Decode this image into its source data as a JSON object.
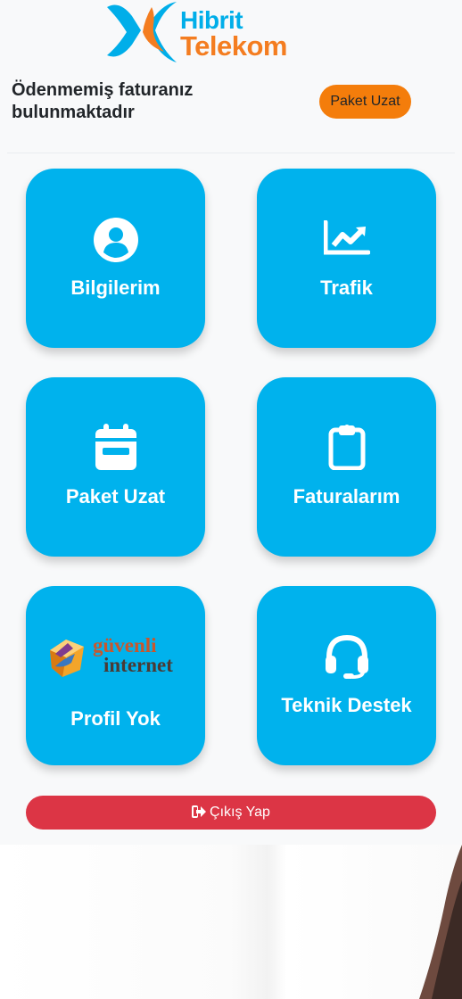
{
  "brand": {
    "line1": "Hibrit",
    "line2": "Telekom"
  },
  "notice": {
    "text": "Ödenmemiş faturanız bulunmaktadır"
  },
  "header": {
    "extend_button_label": "Paket Uzat"
  },
  "tiles": [
    {
      "label": "Bilgilerim",
      "icon": "user-circle-icon"
    },
    {
      "label": "Trafik",
      "icon": "chart-line-icon"
    },
    {
      "label": "Paket Uzat",
      "icon": "calendar-icon"
    },
    {
      "label": "Faturalarım",
      "icon": "clipboard-icon"
    },
    {
      "label": "Profil Yok",
      "icon": "guvenli-internet-logo",
      "logo_text": [
        "güvenli",
        "internet"
      ]
    },
    {
      "label": "Teknik Destek",
      "icon": "headset-icon"
    }
  ],
  "logout": {
    "label": "Çıkış Yap",
    "icon": "sign-out-icon"
  },
  "colors": {
    "accent": "#00b2ed",
    "orange": "#f47d0b",
    "danger": "#dc3545",
    "brand_blue": "#00aee9",
    "brand_orange": "#f47d20"
  }
}
